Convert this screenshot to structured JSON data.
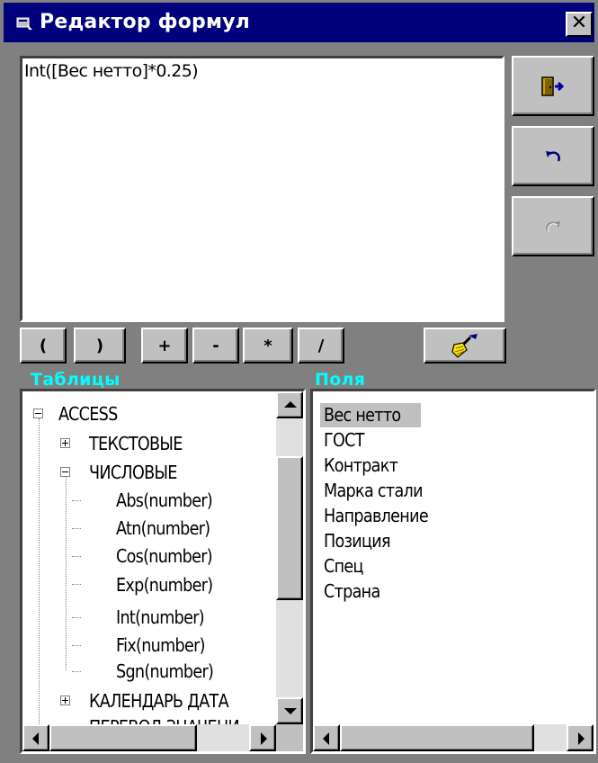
{
  "window": {
    "title": "Редактор формул",
    "close_label": "✕"
  },
  "formula": {
    "text": "Int([Вес нетто]*0.25)"
  },
  "toolbar": {
    "operators": [
      "(",
      ")",
      "+",
      "-",
      "*",
      "/"
    ],
    "exit_icon": "exit-door-icon",
    "undo_icon": "undo-icon",
    "redo_icon": "redo-icon",
    "clear_icon": "broom-icon"
  },
  "labels": {
    "tables": "Таблицы",
    "fields": "Поля"
  },
  "tree": {
    "root": "ACCESS",
    "groups": [
      {
        "label": "ТЕКСТОВЫЕ",
        "expanded": false
      },
      {
        "label": "ЧИСЛОВЫЕ",
        "expanded": true,
        "items": [
          "Abs(number)",
          "Atn(number)",
          "Cos(number)",
          "Exp(number)",
          "Int(number)",
          "Fix(number)",
          "Sgn(number)"
        ]
      },
      {
        "label": "КАЛЕНДАРЬ ДАТА",
        "expanded": false
      },
      {
        "label": "ПЕРЕВОД ЗНАЧЕНИ",
        "expanded": false
      }
    ]
  },
  "fields": {
    "items": [
      "Вес нетто",
      "ГОСТ",
      "Контракт",
      "Марка стали",
      "Направление",
      "Позиция",
      "Спец",
      "Страна"
    ],
    "selected_index": 0
  },
  "colors": {
    "title_bar": "#00007c",
    "label_color": "#00ffff",
    "window_bg": "#808080",
    "button_face": "#c0c0c0"
  }
}
